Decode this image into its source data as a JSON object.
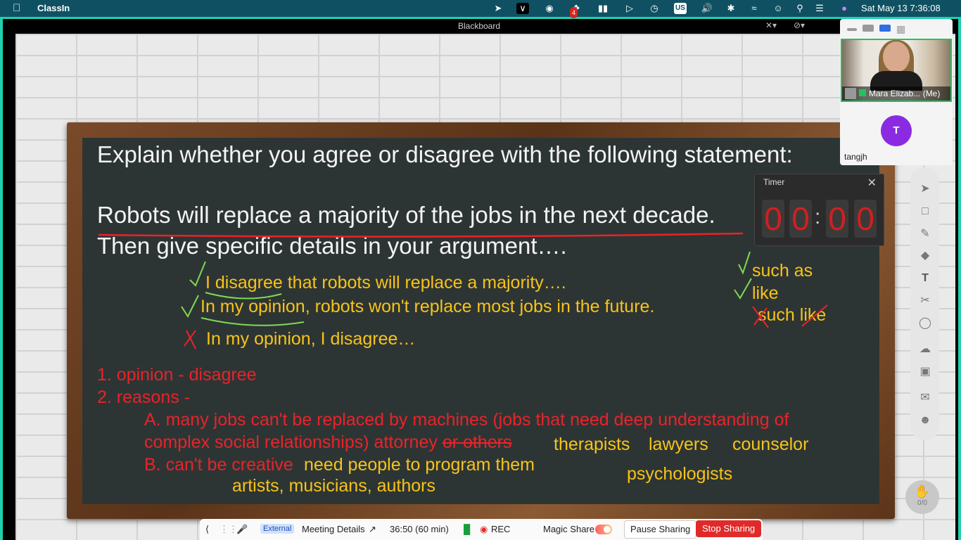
{
  "menubar": {
    "app_name": "ClassIn",
    "clock": "Sat May 13  7:36:08",
    "icons": [
      "apple-icon",
      "feather-icon",
      "chevron-app-icon",
      "wechat-icon",
      "dropbox-icon",
      "battery-icon",
      "play-icon",
      "time-machine-icon",
      "input-source-icon",
      "volume-icon",
      "bluetooth-icon",
      "wifi-icon",
      "user-icon",
      "search-icon",
      "control-center-icon",
      "siri-icon"
    ],
    "dropbox_badge": "4",
    "input_source": "US"
  },
  "window": {
    "title": "Blackboard"
  },
  "board": {
    "prompt_line1": "Explain whether you agree or disagree with the following statement:",
    "statement": "Robots will replace a majority of the jobs in the next decade.",
    "prompt_line3": "Then give specific details in your argument….",
    "yellow_1": "I disagree that robots will replace a majority….",
    "yellow_2": "In my opinion, robots won't replace most jobs in the future.",
    "yellow_3": "In my opinion, I disagree…",
    "side_1": "such as",
    "side_2": "like",
    "side_3a": "such ",
    "side_3b": "like",
    "red_1": "1. opinion - disagree",
    "red_2": "2. reasons -",
    "red_3": "A. many jobs can't be replaced by machines (jobs that need deep understanding of",
    "red_4a": "complex social relationships) attorney ",
    "red_4b": "or others",
    "red_5": "B. can't be creative",
    "yel_therapists": "therapists",
    "yel_lawyers": "lawyers",
    "yel_counselor": "counselor",
    "yel_program": "need people to program them",
    "yel_artists": "artists, musicians, authors",
    "yel_psychologists": "psychologists"
  },
  "timer": {
    "label": "Timer",
    "digits": [
      "0",
      "0",
      "0",
      "0"
    ],
    "separator": ":"
  },
  "participants": {
    "me_name": "Mara Elizab... (Me)",
    "other_initial": "T",
    "other_name": "tangjh"
  },
  "hand_count": "0/0",
  "bottombar": {
    "external": "External",
    "meeting_details": "Meeting Details",
    "duration": "36:50  (60 min)",
    "rec": "REC",
    "magic_share": "Magic Share",
    "pause": "Pause Sharing",
    "stop": "Stop Sharing"
  },
  "colors": {
    "accent_green": "#1fd1ae",
    "board": "#2d3534",
    "ink_red": "#e8232a",
    "ink_yellow": "#f7c31a",
    "stop_red": "#e02a2a"
  }
}
